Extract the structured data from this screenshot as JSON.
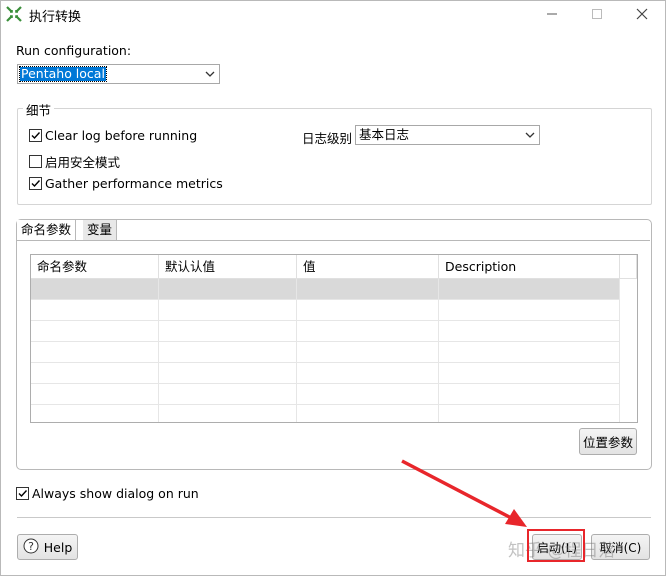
{
  "window": {
    "title": "执行转换",
    "controls": {
      "minimize": "minimize-icon",
      "maximize": "maximize-icon",
      "close": "close-icon"
    }
  },
  "run_config": {
    "label": "Run configuration:",
    "value": "Pentaho local"
  },
  "details": {
    "group_title": "细节",
    "clear_log": {
      "label": "Clear log before running",
      "checked": true
    },
    "safe_mode": {
      "label": "启用安全模式",
      "checked": false
    },
    "gather_metrics": {
      "label": "Gather performance metrics",
      "checked": true
    },
    "log_level": {
      "label": "日志级别",
      "value": "基本日志"
    }
  },
  "tabs": [
    {
      "label": "命名参数",
      "active": true
    },
    {
      "label": "变量",
      "active": false
    }
  ],
  "params_table": {
    "columns": [
      "命名参数",
      "默认认值",
      "值",
      "Description"
    ],
    "rows": [
      [
        "",
        "",
        "",
        ""
      ]
    ]
  },
  "position_params_button": "位置参数",
  "always_show": {
    "label": "Always show dialog on run",
    "checked": true
  },
  "footer": {
    "help_label": "Help",
    "launch_label": "启动(L)",
    "cancel_label": "取消(C)"
  },
  "watermark": "知乎 @程日落",
  "colors": {
    "selection": "#0078d7",
    "annotation": "#e8262b",
    "selected_row": "#d9d9d9"
  }
}
